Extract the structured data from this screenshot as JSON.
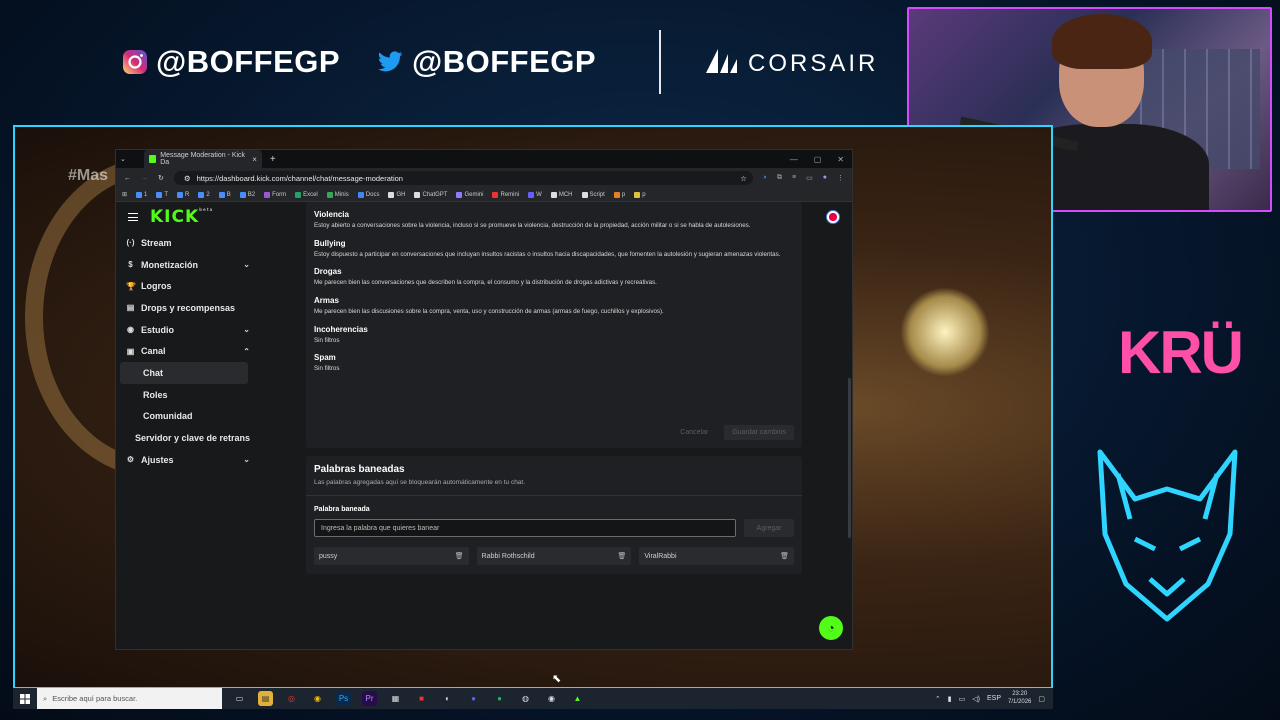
{
  "overlay": {
    "instagram": "@BOFFEGP",
    "twitter": "@BOFFEGP",
    "sponsor": "CORSAIR",
    "team": "KRÜ",
    "stage_tag": "#Mas"
  },
  "browser": {
    "tab_title": "Message Moderation - Kick Da",
    "url": "https://dashboard.kick.com/channel/chat/message-moderation",
    "bookmarks": [
      "1",
      "T",
      "R",
      "2",
      "B",
      "B2",
      "Form",
      "Excel",
      "Minis",
      "Docs",
      "GH",
      "ChatGPT",
      "Gemini",
      "Remini",
      "W",
      "MCH",
      "Script",
      "p",
      "p"
    ]
  },
  "kick": {
    "logo": "KICK",
    "sidebar": [
      {
        "label": "Stream",
        "icon": "(·)",
        "chevron": ""
      },
      {
        "label": "Monetización",
        "icon": "$",
        "chevron": "⌄"
      },
      {
        "label": "Logros",
        "icon": "🏆",
        "chevron": ""
      },
      {
        "label": "Drops y recompensas",
        "icon": "▤",
        "chevron": ""
      },
      {
        "label": "Estudio",
        "icon": "◉",
        "chevron": "⌄"
      },
      {
        "label": "Canal",
        "icon": "▣",
        "chevron": "⌃"
      },
      {
        "label": "Chat"
      },
      {
        "label": "Roles"
      },
      {
        "label": "Comunidad"
      },
      {
        "label": "Servidor y clave de retrans"
      },
      {
        "label": "Ajustes",
        "icon": "⚙",
        "chevron": "⌄"
      }
    ],
    "categories": [
      {
        "title": "Violencia",
        "desc": "Estoy abierto a conversaciones sobre la violencia, incluso si se promueve la violencia, destrucción de la propiedad, acción militar o si se habla de autolesiones."
      },
      {
        "title": "Bullying",
        "desc": "Estoy dispuesto a participar en conversaciones que incluyan insultos racistas o insultos hacia discapacidades, que fomenten la autolesión y sugieran amenazas violentas."
      },
      {
        "title": "Drogas",
        "desc": "Me parecen bien las conversaciones que describen la compra, el consumo y la distribución de drogas adictivas y recreativas."
      },
      {
        "title": "Armas",
        "desc": "Me parecen bien las discusiones sobre la compra, venta, uso y construcción de armas (armas de fuego, cuchillos y explosivos)."
      },
      {
        "title": "Incoherencias",
        "desc": "Sin filtros"
      },
      {
        "title": "Spam",
        "desc": "Sin filtros"
      }
    ],
    "cancel": "Cancelar",
    "save": "Guardar cambios",
    "banned": {
      "title": "Palabras baneadas",
      "subtitle": "Las palabras agregadas aquí se bloquearán automáticamente en tu chat.",
      "label": "Palabra baneada",
      "placeholder": "Ingresa la palabra que quieres banear",
      "add": "Agregar",
      "words": [
        "pussy",
        "Rabbi Rothschild",
        "ViralRabbi"
      ]
    }
  },
  "taskbar": {
    "search_placeholder": "Escribe aquí para buscar.",
    "lang": "ESP",
    "time": "23:20",
    "date": "7/1/2026"
  }
}
